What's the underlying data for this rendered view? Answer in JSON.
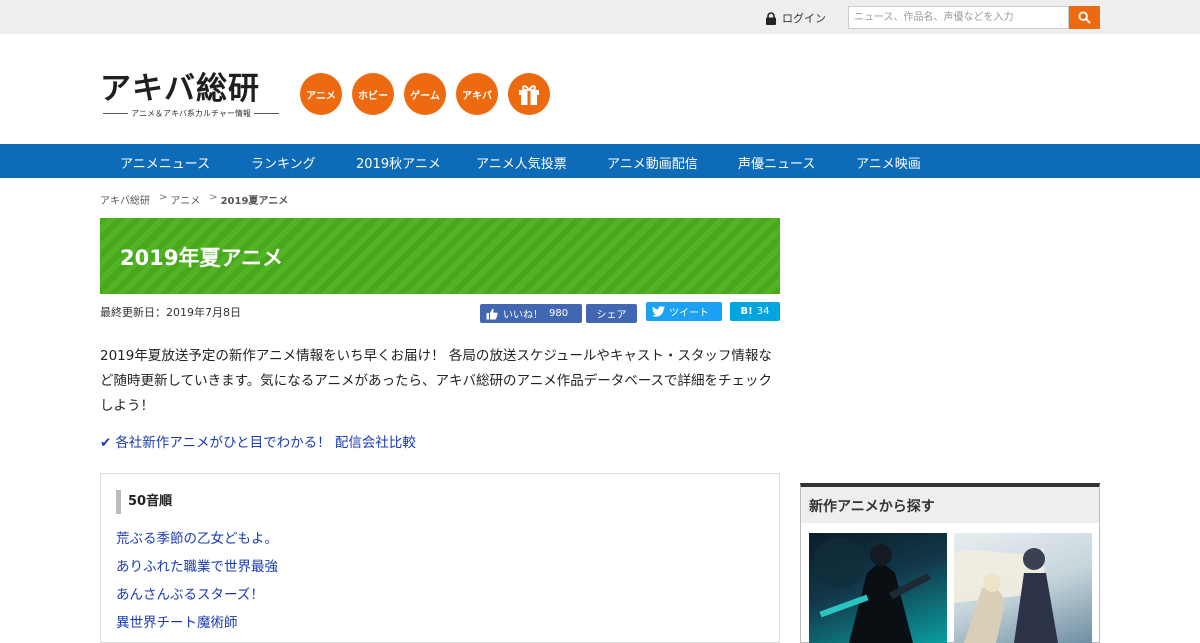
{
  "topbar": {
    "login_label": "ログイン",
    "search_placeholder": "ニュース、作品名、声優などを入力"
  },
  "header": {
    "logo_main": "アキバ総研",
    "logo_sub": "アニメ＆アキバ系カルチャー情報",
    "categories": [
      {
        "label": "アニメ"
      },
      {
        "label": "ホビー"
      },
      {
        "label": "ゲーム"
      },
      {
        "label": "アキバ"
      }
    ],
    "gift_icon": "gift-icon"
  },
  "nav": {
    "items": [
      {
        "label": "アニメニュース"
      },
      {
        "label": "ランキング"
      },
      {
        "label": "2019秋アニメ"
      },
      {
        "label": "アニメ人気投票"
      },
      {
        "label": "アニメ動画配信"
      },
      {
        "label": "声優ニュース"
      },
      {
        "label": "アニメ映画"
      }
    ]
  },
  "breadcrumb": {
    "items": [
      "アキバ総研",
      "アニメ"
    ],
    "current": "2019夏アニメ"
  },
  "page": {
    "title": "2019年夏アニメ",
    "updated": "最終更新日：2019年7月8日",
    "intro": "2019年夏放送予定の新作アニメ情報をいち早くお届け！ 各局の放送スケジュールやキャスト・スタッフ情報など随時更新していきます。気になるアニメがあったら、アキバ総研のアニメ作品データベースで詳細をチェックしよう！",
    "compare_link": "各社新作アニメがひと目でわかる！ 配信会社比較"
  },
  "social": {
    "like_label": "いいね！",
    "like_count": "980",
    "share_label": "シェア",
    "tweet_label": "ツイート",
    "hatena_label": "B!",
    "hatena_count": "34"
  },
  "gojuon": {
    "title": "50音順",
    "links": [
      "荒ぶる季節の乙女どもよ。",
      "ありふれた職業で世界最強",
      "あんさんぶるスターズ！",
      "異世界チート魔術師"
    ]
  },
  "sidebar": {
    "title": "新作アニメから探す"
  },
  "colors": {
    "accent_orange": "#ee6a10",
    "nav_blue": "#0d6bb8",
    "banner_green": "#4cae20",
    "link_blue": "#1a3bb3"
  }
}
